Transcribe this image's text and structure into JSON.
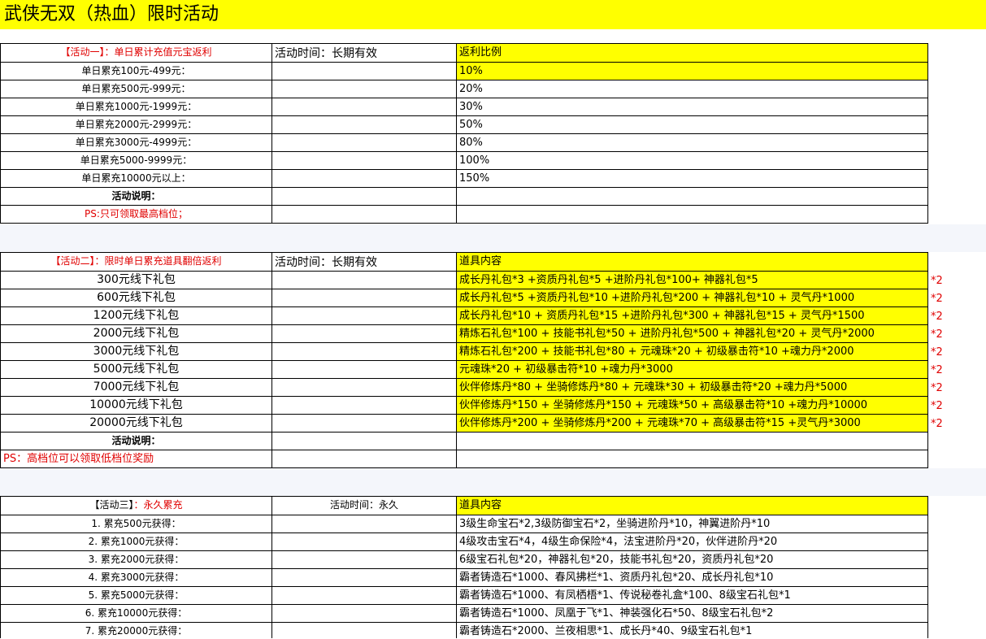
{
  "title": "武侠无双（热血）限时活动",
  "activity1": {
    "header_bracket": "【活动一】",
    "header_name": "：单日累计充值元宝返利",
    "time_label": "活动时间：长期有效",
    "col_header": "返利比例",
    "rows": [
      {
        "tier": "单日累充100元-499元：",
        "rate": "10%"
      },
      {
        "tier": "单日累充500元-999元：",
        "rate": "20%"
      },
      {
        "tier": "单日累充1000元-1999元：",
        "rate": "30%"
      },
      {
        "tier": "单日累充2000元-2999元：",
        "rate": "50%"
      },
      {
        "tier": "单日累充3000元-4999元：",
        "rate": "80%"
      },
      {
        "tier": "单日累充5000-9999元：",
        "rate": "100%"
      },
      {
        "tier": "单日累充10000元以上：",
        "rate": "150%"
      }
    ],
    "note_label": "活动说明：",
    "ps": "PS:只可领取最高档位；"
  },
  "activity2": {
    "header": "【活动二】：限时单日累充道具翻倍返利",
    "time_label": "活动时间：长期有效",
    "col_header": "道具内容",
    "multiplier": "*2",
    "rows": [
      {
        "tier": "300元线下礼包",
        "items": "成长丹礼包*3 +资质丹礼包*5 +进阶丹礼包*100+ 神器礼包*5"
      },
      {
        "tier": "600元线下礼包",
        "items": "成长丹礼包*5 +资质丹礼包*10 +进阶丹礼包*200 + 神器礼包*10 + 灵气丹*1000"
      },
      {
        "tier": "1200元线下礼包",
        "items": "成长丹礼包*10 + 资质丹礼包*15 +进阶丹礼包*300 + 神器礼包*15 + 灵气丹*1500"
      },
      {
        "tier": "2000元线下礼包",
        "items": "精炼石礼包*100 + 技能书礼包*50 + 进阶丹礼包*500 + 神器礼包*20 + 灵气丹*2000"
      },
      {
        "tier": "3000元线下礼包",
        "items": "精炼石礼包*200 + 技能书礼包*80 + 元魂珠*20 + 初级暴击符*10 +魂力丹*2000"
      },
      {
        "tier": "5000元线下礼包",
        "items": "元魂珠*20 + 初级暴击符*10 +魂力丹*3000"
      },
      {
        "tier": "7000元线下礼包",
        "items": "伙伴修炼丹*80 + 坐骑修炼丹*80 + 元魂珠*30 + 初级暴击符*20 +魂力丹*5000"
      },
      {
        "tier": "10000元线下礼包",
        "items": "伙伴修炼丹*150 + 坐骑修炼丹*150 + 元魂珠*50 + 高级暴击符*10 +魂力丹*10000"
      },
      {
        "tier": "20000元线下礼包",
        "items": "伙伴修炼丹*200 + 坐骑修炼丹*200 + 元魂珠*70 + 高级暴击符*15 +灵气丹*3000"
      }
    ],
    "note_label": "活动说明：",
    "ps": "PS：高档位可以领取低档位奖励"
  },
  "activity3": {
    "header_bracket": "【活动三】",
    "header_name": "：永久累充",
    "time_label": "活动时间：永久",
    "col_header": "道具内容",
    "rows": [
      {
        "tier": "1. 累充500元获得：",
        "items": "3级生命宝石*2,3级防御宝石*2，坐骑进阶丹*10，神翼进阶丹*10"
      },
      {
        "tier": "2. 累充1000元获得：",
        "items": "4级攻击宝石*4，4级生命保险*4，法宝进阶丹*20，伙伴进阶丹*20"
      },
      {
        "tier": "3. 累充2000元获得：",
        "items": "6级宝石礼包*20，神器礼包*20，技能书礼包*20，资质丹礼包*20"
      },
      {
        "tier": "4. 累充3000元获得：",
        "items": "霸者铸造石*1000、春风拂栏*1、资质丹礼包*20、成长丹礼包*10"
      },
      {
        "tier": "5. 累充5000元获得：",
        "items": "霸者铸造石*1000、有凤栖梧*1、传说秘卷礼盒*100、8级宝石礼包*1"
      },
      {
        "tier": "6. 累充10000元获得：",
        "items": "霸者铸造石*1000、凤凰于飞*1、神装强化石*50、8级宝石礼包*2"
      },
      {
        "tier": "7. 累充20000元获得：",
        "items": "霸者铸造石*2000、兰夜相思*1、成长丹*40、9级宝石礼包*1"
      }
    ]
  }
}
